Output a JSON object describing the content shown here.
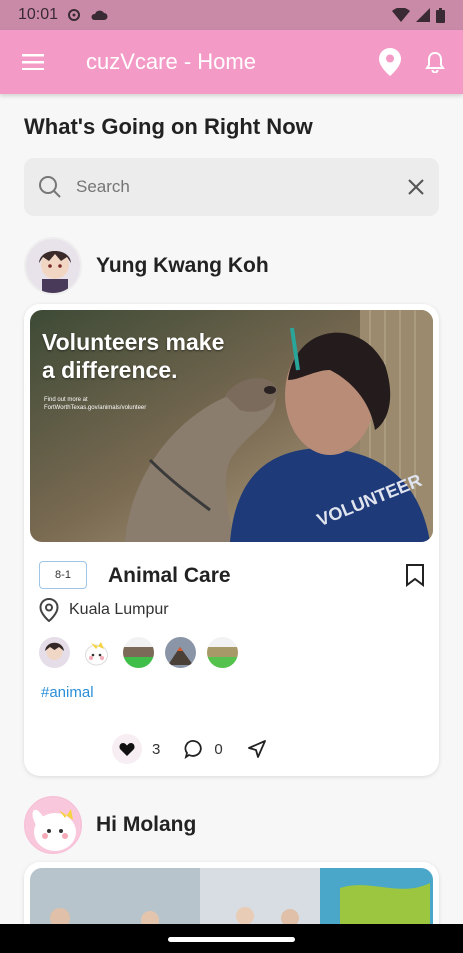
{
  "status": {
    "time": "10:01"
  },
  "appbar": {
    "title": "cuzVcare - Home"
  },
  "main": {
    "heading": "What's Going on Right Now",
    "search": {
      "placeholder": "Search",
      "value": ""
    }
  },
  "posts": [
    {
      "author": "Yung Kwang Koh",
      "image_text": {
        "headline": "Volunteers make a difference.",
        "fine_print": "Find out more at FortWorthTexas.gov/animals/volunteer",
        "shirt": "VOLUNTEER"
      },
      "date": "8-1",
      "title": "Animal Care",
      "location": "Kuala Lumpur",
      "tag": "#animal",
      "likes": "3",
      "comments": "0"
    },
    {
      "author": "Hi Molang"
    }
  ],
  "colors": {
    "appbar": "#f49ac6",
    "status": "#c98aa8",
    "tag": "#2a8fd8"
  }
}
